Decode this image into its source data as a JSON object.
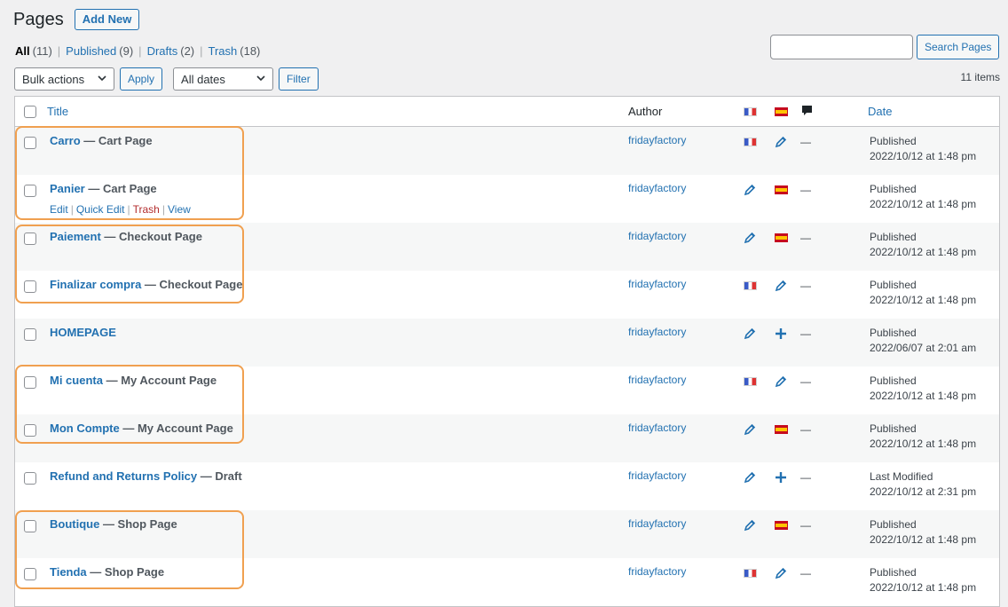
{
  "header": {
    "title": "Pages",
    "add_new": "Add New"
  },
  "filters": {
    "all": {
      "label": "All",
      "count": "(11)"
    },
    "published": {
      "label": "Published",
      "count": "(9)"
    },
    "drafts": {
      "label": "Drafts",
      "count": "(2)"
    },
    "trash": {
      "label": "Trash",
      "count": "(18)"
    },
    "sep": "|"
  },
  "search": {
    "value": "",
    "placeholder": "",
    "button": "Search Pages"
  },
  "tablenav": {
    "bulk_actions": "Bulk actions",
    "apply": "Apply",
    "dates": "All dates",
    "filter": "Filter",
    "items_count": "11 items"
  },
  "table": {
    "columns": {
      "title": "Title",
      "author": "Author",
      "date": "Date"
    },
    "row_actions": {
      "edit": "Edit",
      "quick_edit": "Quick Edit",
      "trash": "Trash",
      "view": "View",
      "sep": "|"
    },
    "rows": [
      {
        "title": "Carro",
        "state": " — Cart Page",
        "author": "fridayfactory",
        "fr": "flag",
        "es": "pencil-icon",
        "status": "Published",
        "date": "2022/10/12 at 1:48 pm",
        "comments": "—"
      },
      {
        "title": "Panier",
        "state": " — Cart Page",
        "author": "fridayfactory",
        "fr": "pencil-icon",
        "es": "flag",
        "status": "Published",
        "date": "2022/10/12 at 1:48 pm",
        "comments": "—"
      },
      {
        "title": "Paiement",
        "state": " — Checkout Page",
        "author": "fridayfactory",
        "fr": "pencil-icon",
        "es": "flag",
        "status": "Published",
        "date": "2022/10/12 at 1:48 pm",
        "comments": "—"
      },
      {
        "title": "Finalizar compra",
        "state": " — Checkout Page",
        "author": "fridayfactory",
        "fr": "flag",
        "es": "pencil-icon",
        "status": "Published",
        "date": "2022/10/12 at 1:48 pm",
        "comments": "—"
      },
      {
        "title": "HOMEPAGE",
        "state": "",
        "author": "fridayfactory",
        "fr": "pencil-icon",
        "es": "plus-icon",
        "status": "Published",
        "date": "2022/06/07 at 2:01 am",
        "comments": "—"
      },
      {
        "title": "Mi cuenta",
        "state": " — My Account Page",
        "author": "fridayfactory",
        "fr": "flag",
        "es": "pencil-icon",
        "status": "Published",
        "date": "2022/10/12 at 1:48 pm",
        "comments": "—"
      },
      {
        "title": "Mon Compte",
        "state": " — My Account Page",
        "author": "fridayfactory",
        "fr": "pencil-icon",
        "es": "flag",
        "status": "Published",
        "date": "2022/10/12 at 1:48 pm",
        "comments": "—"
      },
      {
        "title": "Refund and Returns Policy",
        "state": " — Draft",
        "author": "fridayfactory",
        "fr": "pencil-icon",
        "es": "plus-icon",
        "status": "Last Modified",
        "date": "2022/10/12 at 2:31 pm",
        "comments": "—"
      },
      {
        "title": "Boutique",
        "state": " — Shop Page",
        "author": "fridayfactory",
        "fr": "pencil-icon",
        "es": "flag",
        "status": "Published",
        "date": "2022/10/12 at 1:48 pm",
        "comments": "—"
      },
      {
        "title": "Tienda",
        "state": " — Shop Page",
        "author": "fridayfactory",
        "fr": "flag",
        "es": "pencil-icon",
        "status": "Published",
        "date": "2022/10/12 at 1:48 pm",
        "comments": "—"
      }
    ]
  },
  "colors": {
    "link": "#2271b1",
    "highlight": "#f0a050",
    "trash": "#b32d2e"
  }
}
